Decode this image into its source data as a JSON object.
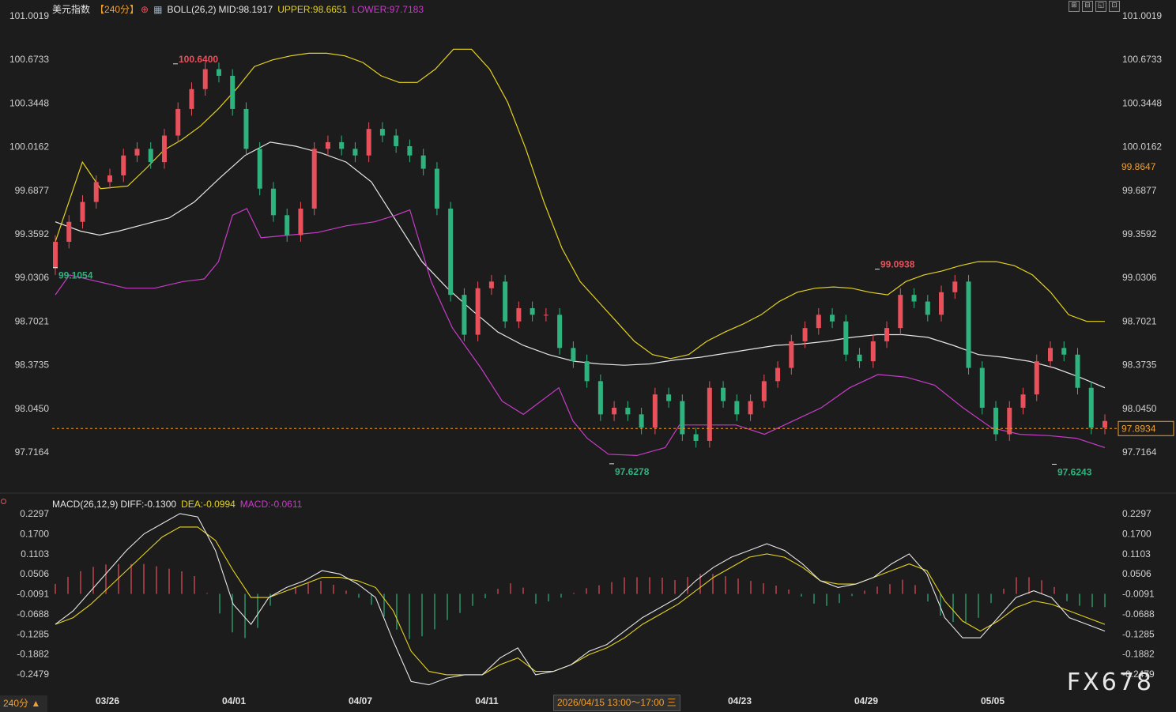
{
  "header": {
    "symbol": "美元指数",
    "period": "【240分】",
    "boll_label": "BOLL(26,2)",
    "mid": "MID:98.1917",
    "upper": "UPPER:98.6651",
    "lower": "LOWER:97.7183",
    "macd_label": "MACD(26,12,9)",
    "diff": "DIFF:-0.1300",
    "dea": "DEA:-0.0994",
    "macd_val": "MACD:-0.0611"
  },
  "toolbar": [
    "⊞",
    "⊟",
    "◱",
    "⊡"
  ],
  "watermark": "FX678",
  "period_badge": "240分 ▲",
  "cursor_time": "2026/04/15 13:00～17:00 三",
  "colors": {
    "up": "#e8505b",
    "down": "#2fb37e",
    "mid": "#e6e6e6",
    "upper": "#e4d21f",
    "lower": "#c83cc8",
    "dea": "#e4d21f",
    "diff": "#e6e6e6",
    "axis_text": "#d0d0d0",
    "current": "#f0a030"
  },
  "chart_data": [
    {
      "type": "candlestick",
      "overlay": "bollinger",
      "y_ticks": [
        "101.0019",
        "100.6733",
        "100.3448",
        "100.0162",
        "99.6877",
        "99.3592",
        "99.0306",
        "98.7021",
        "98.3735",
        "98.0450",
        "97.7164"
      ],
      "ylim": [
        97.55,
        101.05
      ],
      "x_ticks": [
        "03/26",
        "04/01",
        "04/07",
        "04/11",
        "04/23",
        "04/29",
        "05/05"
      ],
      "x_tick_bar_index": [
        5,
        25,
        45,
        65,
        105,
        125,
        145
      ],
      "annotations": [
        {
          "text": "100.6400",
          "bar": 19,
          "value": 100.64,
          "color": "#e8505b"
        },
        {
          "text": "99.1054",
          "bar": 0,
          "value": 99.1054,
          "color": "#2fb37e"
        },
        {
          "text": "97.6278",
          "bar": 88,
          "value": 97.6278,
          "color": "#2fb37e"
        },
        {
          "text": "99.0938",
          "bar": 130,
          "value": 99.0938,
          "color": "#e8505b"
        },
        {
          "text": "97.6243",
          "bar": 158,
          "value": 97.6243,
          "color": "#2fb37e"
        }
      ],
      "current_price": "97.8934",
      "extra_label": "99.8647",
      "upper_band": [
        99.3,
        99.9,
        99.7,
        99.72,
        99.85,
        99.99,
        100.07,
        100.17,
        100.3,
        100.45,
        100.62,
        100.67,
        100.7,
        100.72,
        100.72,
        100.7,
        100.65,
        100.55,
        100.5,
        100.5,
        100.6,
        100.75,
        100.75,
        100.6,
        100.35,
        100.0,
        99.6,
        99.25,
        99.0,
        98.85,
        98.7,
        98.55,
        98.45,
        98.42,
        98.45,
        98.55,
        98.62,
        98.68,
        98.75,
        98.85,
        98.92,
        98.95,
        98.96,
        98.95,
        98.92,
        98.9,
        99.0,
        99.05,
        99.08,
        99.12,
        99.15,
        99.15,
        99.12,
        99.05,
        98.92,
        98.75,
        98.7,
        98.7
      ],
      "upper_x": [
        0,
        3,
        5,
        8,
        10,
        12,
        14,
        16,
        18,
        20,
        22,
        24,
        26,
        28,
        30,
        32,
        34,
        36,
        38,
        40,
        42,
        44,
        46,
        48,
        50,
        52,
        54,
        56,
        58,
        60,
        62,
        64,
        66,
        68,
        70,
        72,
        74,
        76,
        78,
        80,
        82,
        84,
        86,
        88,
        90,
        92,
        94,
        96,
        98,
        100,
        102,
        104,
        106,
        108,
        110,
        112,
        114,
        116
      ],
      "mid_band": [
        99.45,
        99.38,
        99.35,
        99.38,
        99.43,
        99.48,
        99.6,
        99.78,
        99.95,
        100.05,
        100.02,
        99.97,
        99.9,
        99.75,
        99.45,
        99.15,
        98.95,
        98.78,
        98.62,
        98.52,
        98.45,
        98.4,
        98.38,
        98.37,
        98.38,
        98.41,
        98.43,
        98.46,
        98.49,
        98.52,
        98.53,
        98.55,
        98.58,
        98.6,
        98.6,
        98.58,
        98.52,
        98.45,
        98.43,
        98.4,
        98.35,
        98.28,
        98.2
      ],
      "mid_x": [
        0,
        4,
        7,
        10,
        14,
        18,
        22,
        26,
        30,
        34,
        38,
        42,
        46,
        50,
        54,
        58,
        62,
        66,
        70,
        74,
        78,
        82,
        86,
        90,
        94,
        98,
        102,
        106,
        110,
        114,
        118,
        122,
        126,
        130,
        134,
        138,
        142,
        146,
        150,
        154,
        158,
        162,
        166
      ],
      "lower_band": [
        98.9,
        99.05,
        99.0,
        98.95,
        98.95,
        99.0,
        99.02,
        99.15,
        99.5,
        99.55,
        99.33,
        99.35,
        99.37,
        99.42,
        99.45,
        99.5,
        99.54,
        99.0,
        98.65,
        98.35,
        98.1,
        98.0,
        98.12,
        98.2,
        97.95,
        97.82,
        97.7,
        97.69,
        97.75,
        97.92,
        97.92,
        97.92,
        97.85,
        97.95,
        98.05,
        98.2,
        98.3,
        98.28,
        98.22,
        98.05,
        97.9,
        97.85,
        97.84,
        97.82,
        97.75
      ],
      "lower_x": [
        0,
        2,
        6,
        10,
        14,
        18,
        21,
        23,
        25,
        27,
        29,
        33,
        37,
        41,
        45,
        48,
        50,
        53,
        56,
        60,
        63,
        66,
        69,
        71,
        73,
        75,
        78,
        82,
        86,
        88,
        92,
        96,
        100,
        104,
        108,
        112,
        116,
        120,
        124,
        128,
        132,
        136,
        140,
        144,
        148
      ],
      "candles_close": [
        99.3,
        99.45,
        99.6,
        99.75,
        99.8,
        99.95,
        100.0,
        99.9,
        100.1,
        100.3,
        100.45,
        100.6,
        100.55,
        100.3,
        100.0,
        99.7,
        99.5,
        99.35,
        99.55,
        100.0,
        100.05,
        100.0,
        99.95,
        100.15,
        100.1,
        100.02,
        99.95,
        99.85,
        99.55,
        98.9,
        98.6,
        98.95,
        99.0,
        98.7,
        98.8,
        98.75,
        98.75,
        98.5,
        98.4,
        98.25,
        98.0,
        98.05,
        98.0,
        97.9,
        98.15,
        98.1,
        97.85,
        97.8,
        98.2,
        98.1,
        98.0,
        98.1,
        98.25,
        98.35,
        98.55,
        98.65,
        98.75,
        98.7,
        98.45,
        98.4,
        98.55,
        98.65,
        98.9,
        98.85,
        98.75,
        98.92,
        99.0,
        98.35,
        98.05,
        97.85,
        98.05,
        98.15,
        98.4,
        98.5,
        98.45,
        98.2,
        97.9,
        97.95
      ],
      "candles_open": [
        99.1,
        99.3,
        99.45,
        99.6,
        99.75,
        99.8,
        99.95,
        100.0,
        99.9,
        100.1,
        100.3,
        100.45,
        100.6,
        100.55,
        100.3,
        100.0,
        99.7,
        99.5,
        99.35,
        99.55,
        100.0,
        100.05,
        100.0,
        99.95,
        100.15,
        100.1,
        100.02,
        99.95,
        99.85,
        99.55,
        98.9,
        98.6,
        98.95,
        99.0,
        98.7,
        98.8,
        98.75,
        98.75,
        98.5,
        98.4,
        98.25,
        98.0,
        98.05,
        98.0,
        97.9,
        98.15,
        98.1,
        97.85,
        97.8,
        98.2,
        98.1,
        98.0,
        98.1,
        98.25,
        98.35,
        98.55,
        98.65,
        98.75,
        98.7,
        98.45,
        98.4,
        98.55,
        98.65,
        98.9,
        98.85,
        98.75,
        98.92,
        99.0,
        98.35,
        98.05,
        97.85,
        98.05,
        98.15,
        98.4,
        98.5,
        98.45,
        98.2,
        97.9
      ]
    },
    {
      "type": "macd",
      "y_ticks": [
        "0.2297",
        "0.1700",
        "0.1103",
        "0.0506",
        "-0.0091",
        "-0.0688",
        "-0.1285",
        "-0.1882",
        "-0.2479"
      ],
      "ylim": [
        -0.3,
        0.26
      ],
      "series": [
        {
          "name": "DIFF",
          "values": [
            -0.1,
            -0.06,
            -0.0,
            0.06,
            0.12,
            0.17,
            0.2,
            0.23,
            0.22,
            0.12,
            -0.04,
            -0.1,
            -0.02,
            0.01,
            0.03,
            0.06,
            0.05,
            0.02,
            -0.02,
            -0.15,
            -0.27,
            -0.28,
            -0.26,
            -0.25,
            -0.25,
            -0.2,
            -0.17,
            -0.25,
            -0.24,
            -0.22,
            -0.18,
            -0.16,
            -0.12,
            -0.08,
            -0.05,
            -0.02,
            0.03,
            0.07,
            0.1,
            0.12,
            0.14,
            0.12,
            0.08,
            0.03,
            0.01,
            0.02,
            0.04,
            0.08,
            0.11,
            0.05,
            -0.08,
            -0.14,
            -0.14,
            -0.08,
            -0.02,
            0.0,
            -0.02,
            -0.08,
            -0.1,
            -0.12
          ]
        },
        {
          "name": "DEA",
          "values": [
            -0.1,
            -0.08,
            -0.04,
            0.01,
            0.06,
            0.11,
            0.16,
            0.19,
            0.19,
            0.15,
            0.06,
            -0.02,
            -0.02,
            0.0,
            0.02,
            0.04,
            0.04,
            0.03,
            0.01,
            -0.06,
            -0.18,
            -0.24,
            -0.25,
            -0.25,
            -0.25,
            -0.22,
            -0.2,
            -0.24,
            -0.24,
            -0.22,
            -0.19,
            -0.17,
            -0.14,
            -0.1,
            -0.07,
            -0.04,
            0.0,
            0.04,
            0.07,
            0.1,
            0.11,
            0.1,
            0.07,
            0.03,
            0.02,
            0.02,
            0.04,
            0.06,
            0.08,
            0.06,
            -0.03,
            -0.09,
            -0.12,
            -0.09,
            -0.05,
            -0.03,
            -0.04,
            -0.06,
            -0.08,
            -0.1
          ]
        },
        {
          "name": "MACD",
          "values": [
            0.03,
            0.06,
            0.08,
            0.09,
            0.09,
            0.09,
            0.08,
            0.07,
            0.05,
            -0.04,
            -0.12,
            -0.14,
            -0.04,
            0.01,
            0.03,
            0.04,
            0.02,
            -0.01,
            -0.04,
            -0.1,
            -0.14,
            -0.12,
            -0.08,
            -0.05,
            -0.02,
            0.02,
            0.04,
            -0.03,
            -0.02,
            0.0,
            0.02,
            0.03,
            0.05,
            0.05,
            0.05,
            0.04,
            0.06,
            0.06,
            0.05,
            0.04,
            0.03,
            0.02,
            -0.01,
            -0.04,
            -0.03,
            0.0,
            0.02,
            0.03,
            0.05,
            -0.02,
            -0.08,
            -0.09,
            -0.07,
            0.0,
            0.05,
            0.05,
            0.03,
            -0.03,
            -0.04,
            -0.04
          ]
        }
      ]
    }
  ]
}
